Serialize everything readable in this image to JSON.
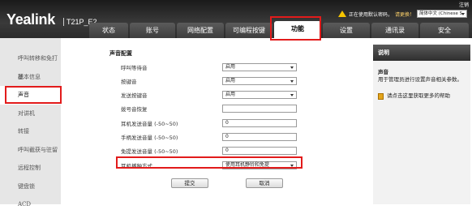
{
  "header": {
    "logo": "Yealink",
    "model": "T21P_E2",
    "logout": "注销",
    "warning": "正在使用默认密码，",
    "warning_link": "请更换！",
    "language": "简体中文 (Chinese S"
  },
  "tabs": [
    {
      "label": "状态"
    },
    {
      "label": "账号"
    },
    {
      "label": "网络配置"
    },
    {
      "label": "可编程按键"
    },
    {
      "label": "功能"
    },
    {
      "label": "设置"
    },
    {
      "label": "通讯录"
    },
    {
      "label": "安全"
    }
  ],
  "sidebar": {
    "items": [
      {
        "label": "呼叫转移和免打扰"
      },
      {
        "label": "基本信息"
      },
      {
        "label": "声音"
      },
      {
        "label": "对讲机"
      },
      {
        "label": "转接"
      },
      {
        "label": "呼叫截获与驻留"
      },
      {
        "label": "远程控制"
      },
      {
        "label": "键盘锁"
      },
      {
        "label": "ACD"
      }
    ]
  },
  "form": {
    "title": "声音配置",
    "rows": [
      {
        "label": "呼叫等待音",
        "value": "启用"
      },
      {
        "label": "按键音",
        "value": "启用"
      },
      {
        "label": "发送按键音",
        "value": "启用"
      },
      {
        "label": "拨号音恢复",
        "value": ""
      },
      {
        "label": "耳机发送音量 (-50~50)",
        "value": "0"
      },
      {
        "label": "手柄发送音量 (-50~50)",
        "value": "0"
      },
      {
        "label": "免提发送音量 (-50~50)",
        "value": "0"
      },
      {
        "label": "耳机播种方式",
        "value": "使用耳机静铃和免提"
      }
    ],
    "submit": "提交",
    "cancel": "取消"
  },
  "help": {
    "title": "说明",
    "heading": "声音",
    "text": "用于管理员进行设置声音相关参数。",
    "more": "请点击这里获取更多的帮助"
  }
}
